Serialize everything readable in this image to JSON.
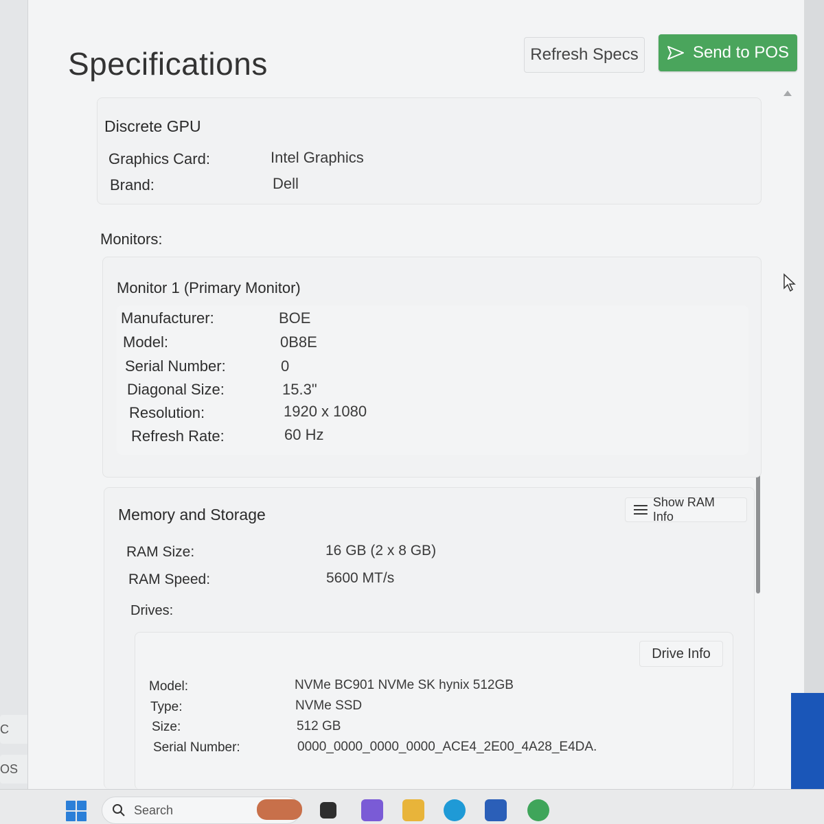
{
  "header": {
    "title": "Specifications",
    "refresh_label": "Refresh Specs",
    "send_label": "Send to POS"
  },
  "gpu": {
    "heading": "Discrete GPU",
    "rows": [
      {
        "label": "Graphics Card:",
        "value": "Intel Graphics"
      },
      {
        "label": "Brand:",
        "value": "Dell"
      }
    ]
  },
  "monitors": {
    "heading": "Monitors:",
    "monitor1": {
      "title": "Monitor 1 (Primary Monitor)",
      "rows": [
        {
          "label": "Manufacturer:",
          "value": "BOE"
        },
        {
          "label": "Model:",
          "value": "0B8E"
        },
        {
          "label": "Serial Number:",
          "value": "0"
        },
        {
          "label": "Diagonal Size:",
          "value": "15.3\""
        },
        {
          "label": "Resolution:",
          "value": "1920 x 1080"
        },
        {
          "label": "Refresh Rate:",
          "value": "60 Hz"
        }
      ]
    }
  },
  "memory": {
    "heading": "Memory and Storage",
    "show_ram_label": "Show RAM Info",
    "rows": [
      {
        "label": "RAM Size:",
        "value": "16 GB (2 x 8 GB)"
      },
      {
        "label": "RAM Speed:",
        "value": "5600 MT/s"
      }
    ],
    "drives_heading": "Drives:",
    "drive_info_label": "Drive Info",
    "drive": [
      {
        "label": "Model:",
        "value": "NVMe BC901 NVMe SK hynix 512GB"
      },
      {
        "label": "Type:",
        "value": "NVMe SSD"
      },
      {
        "label": "Size:",
        "value": "512 GB"
      },
      {
        "label": "Serial Number:",
        "value": "0000_0000_0000_0000_ACE4_2E00_4A28_E4DA."
      }
    ]
  },
  "left_panel": {
    "item1": "C",
    "item2": "OS"
  },
  "taskbar": {
    "search_placeholder": "Search"
  },
  "colors": {
    "accent_green": "#4aa55c",
    "start_blue": "#2b7fd8"
  }
}
